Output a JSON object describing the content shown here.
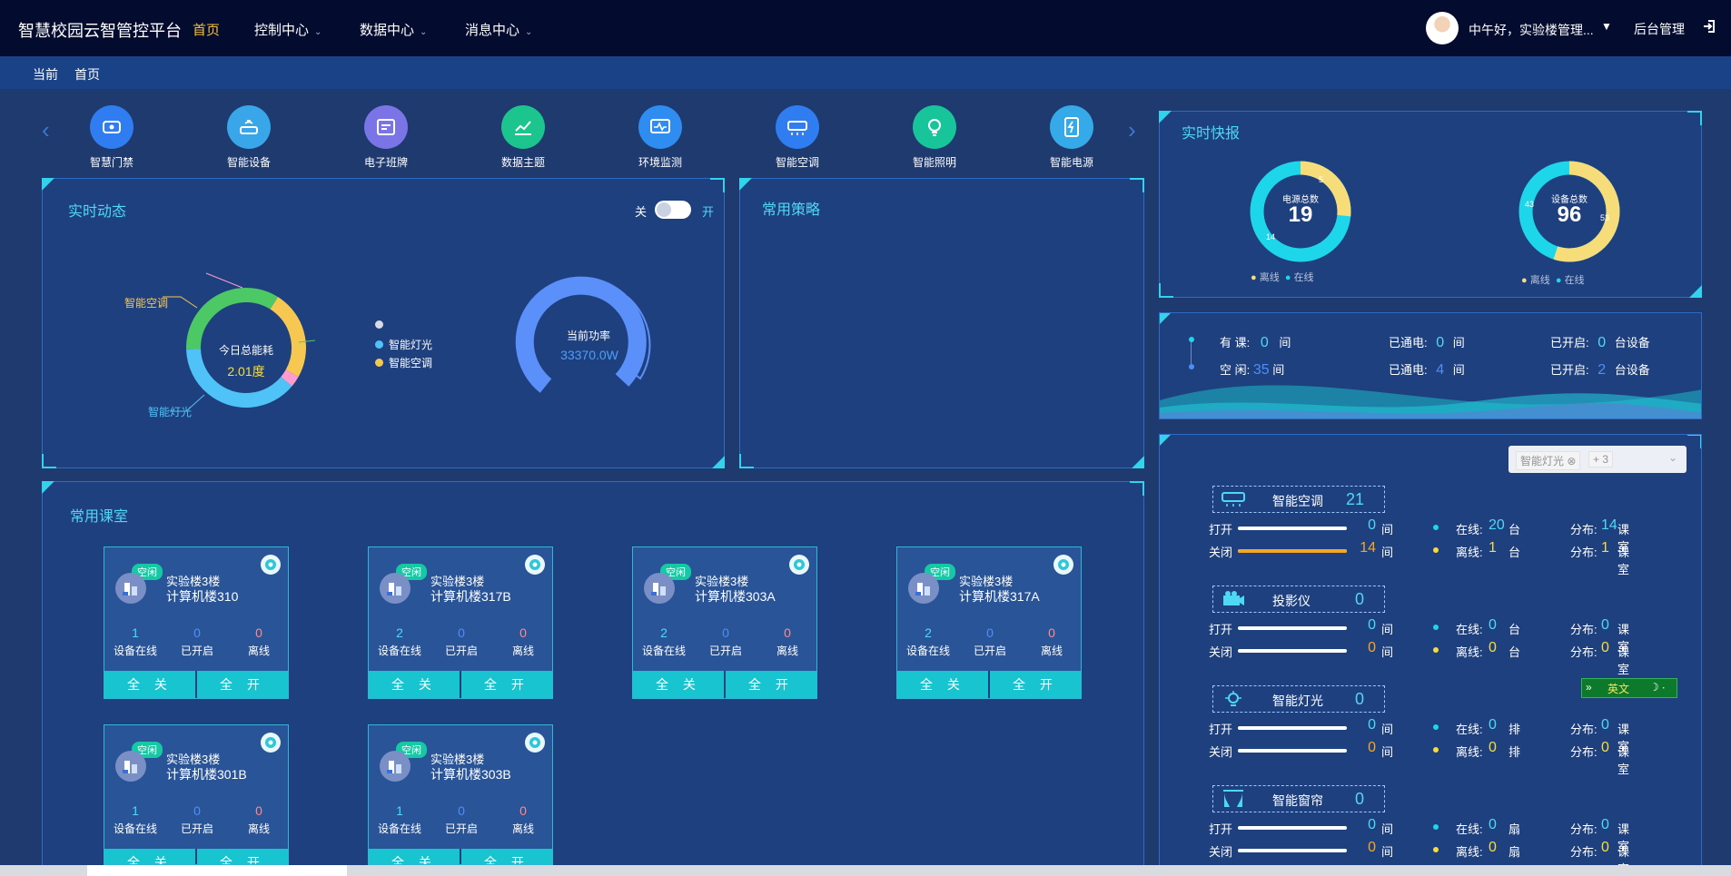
{
  "header": {
    "title": "智慧校园云智管控平台",
    "nav": [
      {
        "label": "首页",
        "active": true,
        "dropdown": false
      },
      {
        "label": "控制中心",
        "active": false,
        "dropdown": true
      },
      {
        "label": "数据中心",
        "active": false,
        "dropdown": true
      },
      {
        "label": "消息中心",
        "active": false,
        "dropdown": true
      }
    ],
    "greeting": "中午好，实验楼管理...",
    "admin": "后台管理"
  },
  "breadcrumb": {
    "current": "当前",
    "page": "首页"
  },
  "quick_menu": [
    {
      "label": "智慧门禁",
      "icon": "door-access-icon",
      "color": "#2f7df0"
    },
    {
      "label": "智能设备",
      "icon": "router-icon",
      "color": "#3aa6ea"
    },
    {
      "label": "电子班牌",
      "icon": "class-board-icon",
      "color": "#7a74e6"
    },
    {
      "label": "数据主题",
      "icon": "chart-trend-icon",
      "color": "#1cc58d"
    },
    {
      "label": "环境监测",
      "icon": "monitor-icon",
      "color": "#2f8cf0"
    },
    {
      "label": "智能空调",
      "icon": "air-conditioner-icon",
      "color": "#2f7df0"
    },
    {
      "label": "智能照明",
      "icon": "light-bulb-icon",
      "color": "#18c59a"
    },
    {
      "label": "智能电源",
      "icon": "power-icon",
      "color": "#36a9e8"
    }
  ],
  "realtime": {
    "title": "实时动态",
    "toggle_off": "关",
    "toggle_on": "开",
    "donut_center_label": "今日总能耗",
    "donut_center_value": "2.01度",
    "label_ac": "智能空调",
    "label_light": "智能灯光",
    "legend": [
      "",
      "智能灯光",
      "智能空调"
    ],
    "gauge_label": "当前功率",
    "gauge_value": "33370.0W"
  },
  "strategy": {
    "title": "常用策略"
  },
  "classrooms": {
    "title": "常用课室",
    "status_tag": "空闲",
    "stat_labels": [
      "设备在线",
      "已开启",
      "离线"
    ],
    "btn_off": "全 关",
    "btn_on": "全 开",
    "items": [
      {
        "building": "实验楼3楼",
        "room": "计算机楼310",
        "online": "1",
        "opened": "0",
        "offline": "0"
      },
      {
        "building": "实验楼3楼",
        "room": "计算机楼317B",
        "online": "2",
        "opened": "0",
        "offline": "0"
      },
      {
        "building": "实验楼3楼",
        "room": "计算机楼303A",
        "online": "2",
        "opened": "0",
        "offline": "0"
      },
      {
        "building": "实验楼3楼",
        "room": "计算机楼317A",
        "online": "2",
        "opened": "0",
        "offline": "0"
      },
      {
        "building": "实验楼3楼",
        "room": "计算机楼301B",
        "online": "1",
        "opened": "0",
        "offline": "0"
      },
      {
        "building": "实验楼3楼",
        "room": "计算机楼303B",
        "online": "1",
        "opened": "0",
        "offline": "0"
      }
    ]
  },
  "quick_report": {
    "title": "实时快报",
    "power": {
      "label": "电源总数",
      "total": "19",
      "offline": "5",
      "online": "14"
    },
    "device": {
      "label": "设备总数",
      "total": "96",
      "offline": "53",
      "online": "43"
    },
    "legend_offline": "离线",
    "legend_online": "在线"
  },
  "room_status": {
    "has_class_label": "有 课:",
    "has_class_value": "0",
    "idle_label": "空 闲:",
    "idle_value": "35",
    "room_unit": "间",
    "powered_label": "已通电:",
    "powered_a": "0",
    "powered_b": "4",
    "opened_label": "已开启:",
    "opened_a": "0",
    "opened_b": "2",
    "device_unit": "台设备"
  },
  "filter": {
    "selected": "智能灯光",
    "more": "+ 3"
  },
  "devices": [
    {
      "name": "智能空调",
      "count": "21",
      "icon": "air-conditioner-icon",
      "open": "0",
      "closed": "14",
      "closed_ratio": 1.0,
      "unit": "台",
      "online": "20",
      "offline": "1",
      "dist_online": "14",
      "dist_offline": "1"
    },
    {
      "name": "投影仪",
      "count": "0",
      "icon": "projector-icon",
      "open": "0",
      "closed": "0",
      "closed_ratio": 0,
      "unit": "台",
      "online": "0",
      "offline": "0",
      "dist_online": "0",
      "dist_offline": "0"
    },
    {
      "name": "智能灯光",
      "count": "0",
      "icon": "light-bulb-icon",
      "open": "0",
      "closed": "0",
      "closed_ratio": 0,
      "unit": "排",
      "online": "0",
      "offline": "0",
      "dist_online": "0",
      "dist_offline": "0"
    },
    {
      "name": "智能窗帘",
      "count": "0",
      "icon": "curtain-icon",
      "open": "0",
      "closed": "0",
      "closed_ratio": 0,
      "unit": "扇",
      "online": "0",
      "offline": "0",
      "dist_online": "0",
      "dist_offline": "0"
    }
  ],
  "device_labels": {
    "open": "打开",
    "closed": "关闭",
    "room_unit": "间",
    "online": "在线:",
    "offline": "离线:",
    "dist": "分布:",
    "dist_unit": "课室"
  },
  "ime": {
    "lang": "英文"
  },
  "colors": {
    "cyan": "#4fd8f4",
    "orange": "#f5a623",
    "yellow": "#f7dd3a",
    "green": "#4cc964",
    "pink": "#ff8a8a",
    "blue_bar": "#5b8ff9"
  }
}
